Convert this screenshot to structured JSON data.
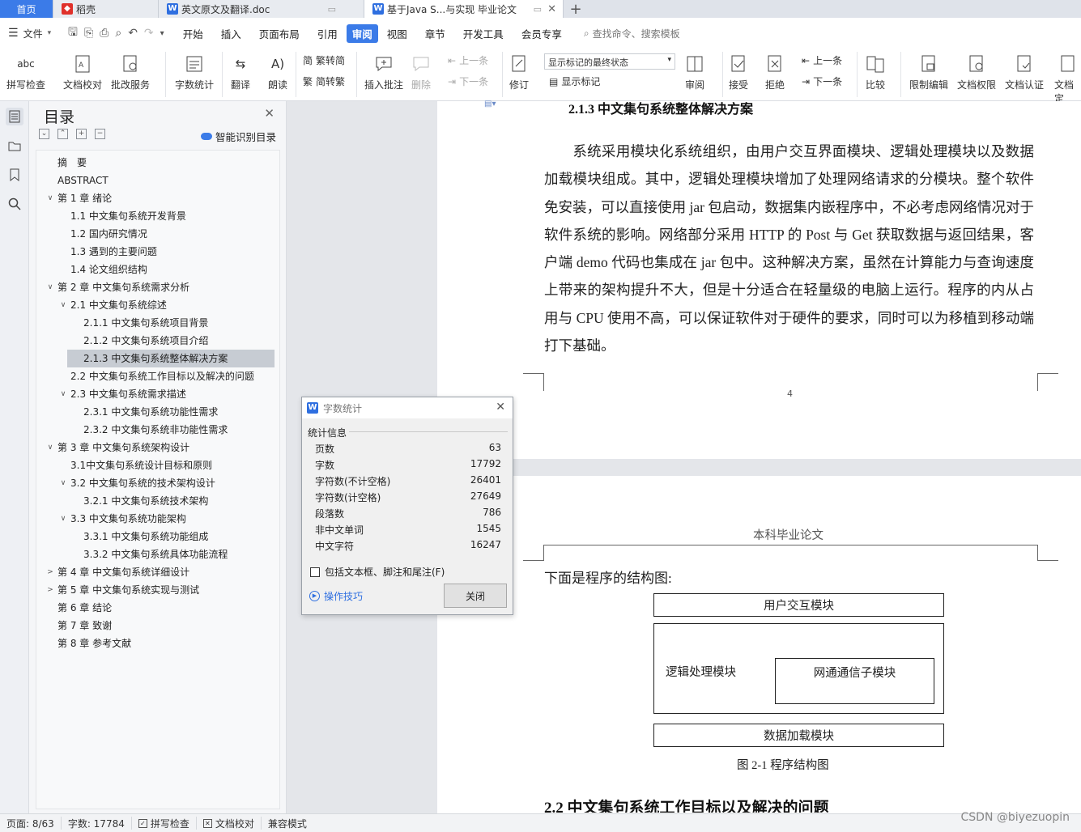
{
  "tabs": [
    {
      "label": "首页",
      "icon": ""
    },
    {
      "label": "稻壳",
      "icon": "docer-icon"
    },
    {
      "label": "英文原文及翻译.doc",
      "icon": "wps-writer-icon"
    },
    {
      "label": "基于Java S...与实现 毕业论文",
      "icon": "wps-writer-icon"
    }
  ],
  "menubar": {
    "file_label": "文件",
    "items": [
      "开始",
      "插入",
      "页面布局",
      "引用",
      "审阅",
      "视图",
      "章节",
      "开发工具",
      "会员专享"
    ],
    "active": "审阅",
    "search_placeholder": "查找命令、搜索模板"
  },
  "ribbon": {
    "spell_check": "拼写检查",
    "doc_proof": "文档校对",
    "review_service": "批改服务",
    "word_count": "字数统计",
    "translate": "翻译",
    "read_aloud": "朗读",
    "trad_to_simp": "繁转简",
    "simp_to_trad": "简转繁",
    "insert_comment": "插入批注",
    "delete": "删除",
    "prev_comment": "上一条",
    "next_comment": "下一条",
    "revise": "修订",
    "markup_state": "显示标记的最终状态",
    "show_markup": "显示标记",
    "review": "审阅",
    "accept": "接受",
    "reject": "拒绝",
    "prev_change": "上一条",
    "next_change": "下一条",
    "compare": "比较",
    "restrict_edit": "限制编辑",
    "doc_permission": "文档权限",
    "doc_certify": "文档认证",
    "doc_final": "文档定"
  },
  "toc": {
    "title": "目录",
    "smart_label": "智能识别目录",
    "items": [
      {
        "text": "摘　要",
        "level": 1,
        "expand": ""
      },
      {
        "text": "ABSTRACT",
        "level": 1,
        "expand": ""
      },
      {
        "text": "第 1 章  绪论",
        "level": 1,
        "expand": "open"
      },
      {
        "text": "1.1  中文集句系统开发背景",
        "level": 2,
        "expand": ""
      },
      {
        "text": "1.2  国内研究情况",
        "level": 2,
        "expand": ""
      },
      {
        "text": "1.3  遇到的主要问题",
        "level": 2,
        "expand": ""
      },
      {
        "text": "1.4  论文组织结构",
        "level": 2,
        "expand": ""
      },
      {
        "text": "第 2 章  中文集句系统需求分析",
        "level": 1,
        "expand": "open"
      },
      {
        "text": "2.1  中文集句系统综述",
        "level": 2,
        "expand": "open"
      },
      {
        "text": "2.1.1  中文集句系统项目背景",
        "level": 3,
        "expand": ""
      },
      {
        "text": "2.1.2  中文集句系统项目介绍",
        "level": 3,
        "expand": ""
      },
      {
        "text": "2.1.3  中文集句系统整体解决方案",
        "level": 3,
        "expand": "",
        "selected": true
      },
      {
        "text": "2.2  中文集句系统工作目标以及解决的问题",
        "level": 2,
        "expand": ""
      },
      {
        "text": "2.3  中文集句系统需求描述",
        "level": 2,
        "expand": "open"
      },
      {
        "text": "2.3.1  中文集句系统功能性需求",
        "level": 3,
        "expand": ""
      },
      {
        "text": "2.3.2  中文集句系统非功能性需求",
        "level": 3,
        "expand": ""
      },
      {
        "text": "第 3 章  中文集句系统架构设计",
        "level": 1,
        "expand": "open"
      },
      {
        "text": "3.1中文集句系统设计目标和原则",
        "level": 2,
        "expand": ""
      },
      {
        "text": "3.2  中文集句系统的技术架构设计",
        "level": 2,
        "expand": "open"
      },
      {
        "text": "3.2.1  中文集句系统技术架构",
        "level": 3,
        "expand": ""
      },
      {
        "text": "3.3  中文集句系统功能架构",
        "level": 2,
        "expand": "open"
      },
      {
        "text": "3.3.1    中文集句系统功能组成",
        "level": 3,
        "expand": ""
      },
      {
        "text": "3.3.2    中文集句系统具体功能流程",
        "level": 3,
        "expand": ""
      },
      {
        "text": "第 4 章  中文集句系统详细设计",
        "level": 1,
        "expand": "closed"
      },
      {
        "text": "第 5 章  中文集句系统实现与测试",
        "level": 1,
        "expand": "closed"
      },
      {
        "text": "第 6 章  结论",
        "level": 1,
        "expand": ""
      },
      {
        "text": "第 7 章  致谢",
        "level": 1,
        "expand": ""
      },
      {
        "text": "第 8 章  参考文献",
        "level": 1,
        "expand": ""
      }
    ]
  },
  "document": {
    "heading_213": "2.1.3  中文集句系统整体解决方案",
    "paragraph": "系统采用模块化系统组织，由用户交互界面模块、逻辑处理模块以及数据加载模块组成。其中，逻辑处理模块增加了处理网络请求的分模块。整个软件免安装，可以直接使用 jar 包启动，数据集内嵌程序中，不必考虑网络情况对于软件系统的影响。网络部分采用 HTTP 的 Post 与 Get 获取数据与返回结果，客户端 demo 代码也集成在 jar 包中。这种解决方案，虽然在计算能力与查询速度上带来的架构提升不大，但是十分适合在轻量级的电脑上运行。程序的内从占用与 CPU 使用不高，可以保证软件对于硬件的要求，同时可以为移植到移动端打下基础。",
    "page_number": "4",
    "page_header": "本科毕业论文",
    "struct_intro": "下面是程序的结构图:",
    "diagram": {
      "ui_module": "用户交互模块",
      "logic_module": "逻辑处理模块",
      "network_module": "网通通信子模块",
      "data_module": "数据加载模块"
    },
    "figure_caption": "图 2-1 程序结构图",
    "heading_22": "2.2  中文集句系统工作目标以及解决的问题"
  },
  "dialog": {
    "title": "字数统计",
    "group": "统计信息",
    "stats": [
      {
        "label": "页数",
        "value": "63"
      },
      {
        "label": "字数",
        "value": "17792"
      },
      {
        "label": "字符数(不计空格)",
        "value": "26401"
      },
      {
        "label": "字符数(计空格)",
        "value": "27649"
      },
      {
        "label": "段落数",
        "value": "786"
      },
      {
        "label": "非中文单词",
        "value": "1545"
      },
      {
        "label": "中文字符",
        "value": "16247"
      }
    ],
    "checkbox_label": "包括文本框、脚注和尾注(F)",
    "tips_label": "操作技巧",
    "close_button": "关闭"
  },
  "statusbar": {
    "page": "页面: 8/63",
    "words": "字数: 17784",
    "spell_check": "拼写检查",
    "doc_proof": "文档校对",
    "compat_mode": "兼容模式"
  },
  "watermark": "CSDN @biyezuopin"
}
